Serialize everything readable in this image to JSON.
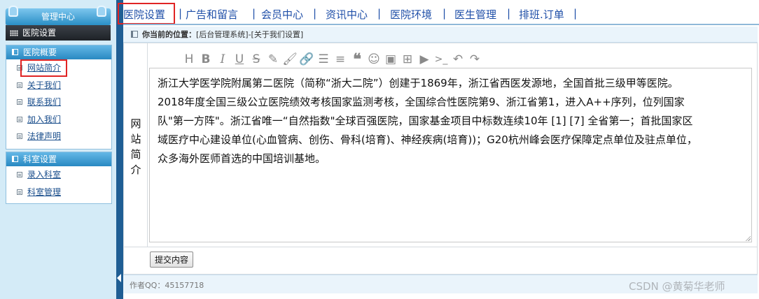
{
  "sidebar": {
    "title": "管理中心",
    "hospital_settings": "医院设置",
    "panels": [
      {
        "title": "医院概要",
        "items": [
          "网站简介",
          "关于我们",
          "联系我们",
          "加入我们",
          "法律声明"
        ]
      },
      {
        "title": "科室设置",
        "items": [
          "录入科室",
          "科室管理"
        ]
      }
    ]
  },
  "nav": {
    "tabs": [
      "医院设置",
      "广告和留言",
      "会员中心",
      "资讯中心",
      "医院环境",
      "医生管理",
      "排班.订单"
    ],
    "separator": "|",
    "active_index": 0
  },
  "breadcrumb": {
    "label": "你当前的位置：",
    "path": "[后台管理系统]-[关于我们设置]"
  },
  "form": {
    "field_label": "网站简介",
    "toolbar_icons": [
      "heading-icon",
      "bold-icon",
      "italic-icon",
      "underline-icon",
      "strikethrough-icon",
      "pencil-icon",
      "brush-icon",
      "link-icon",
      "unordered-list-icon",
      "align-left-icon",
      "quote-icon",
      "emoji-icon",
      "image-icon",
      "table-icon",
      "video-icon",
      "code-icon",
      "undo-icon",
      "redo-icon"
    ],
    "editor_lines": [
      "浙江大学医学院附属第二医院（简称“浙大二院”）创建于1869年，浙江省西医发源地，全国首批三级甲等医院。",
      "2018年度全国三级公立医院绩效考核国家监测考核，全国综合性医院第9、浙江省第1，进入A++序列，位列国家",
      "队\"第一方阵\"。浙江省唯一“自然指数\"全球百强医院，国家基金项目中标数连续10年 [1] [7] 全省第一；首批国家区",
      "域医疗中心建设单位(心血管病、创伤、骨科(培育)、神经疾病(培育))；G20杭州峰会医疗保障定点单位及驻点单位，",
      "众多海外医师首选的中国培训基地。"
    ],
    "submit_label": "提交内容"
  },
  "footer": {
    "author": "作者QQ：45157718"
  },
  "watermark": "CSDN @黄菊华老师",
  "colors": {
    "sidebar_bg": "#d4ebf7",
    "panel_header": "#2989c2",
    "link": "#1a4e8c",
    "nav_text": "#1f4fa8",
    "highlight": "#e02424"
  }
}
